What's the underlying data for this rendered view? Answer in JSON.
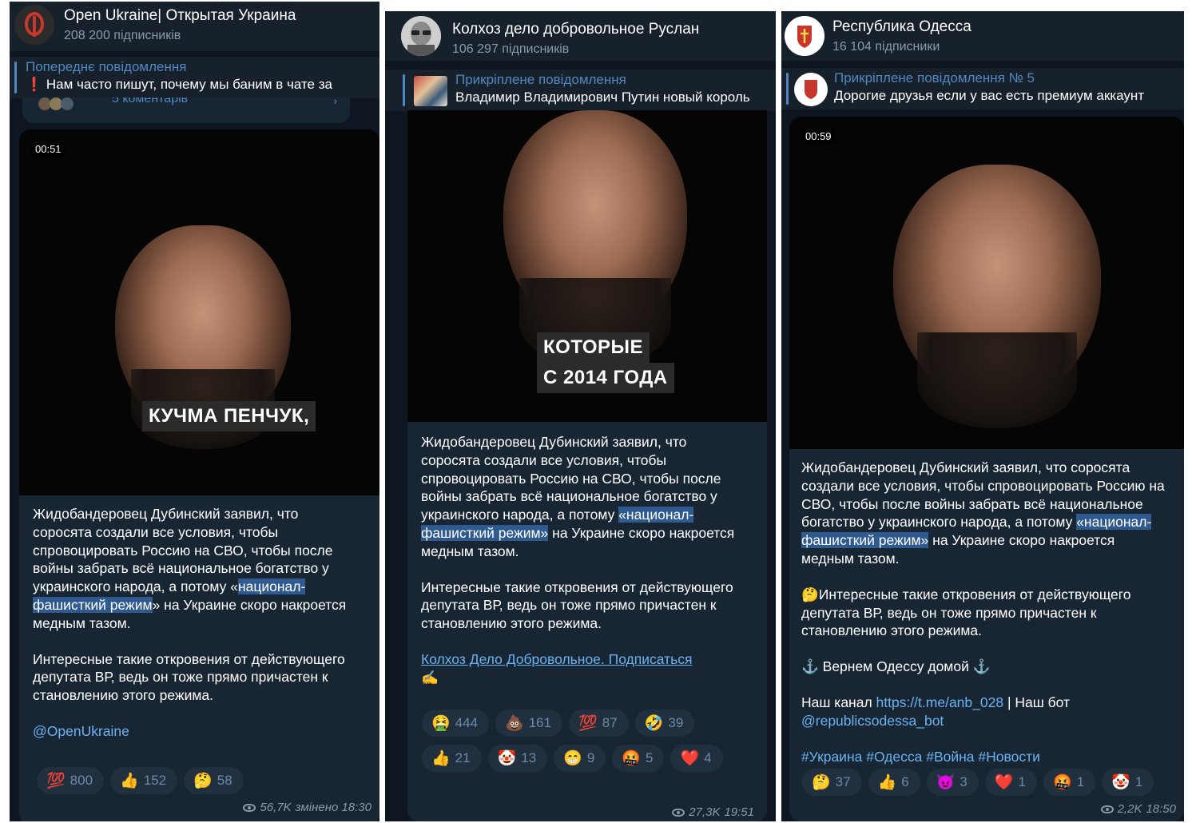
{
  "panel1": {
    "channel_title": "Open Ukraine| Открытая Украина",
    "subscribers": "208 200 підписників",
    "pinned_label": "Попереднє повідомлення",
    "pinned_text": "Нам часто пишут, почему мы баним в чате за",
    "pinned_prefix": "❗",
    "comments_peek": "5 коментарів",
    "video_time": "00:51",
    "video_caption": "КУЧМА ПЕНЧУК,",
    "body_before": "Жидобандеровец Дубинский заявил, что соросята создали все условия, чтобы спровоцировать Россию на СВО, чтобы после войны забрать всё национальное богатство у украинского народа, а потому «",
    "body_highlight": "национал-фашисткий режим",
    "body_after": "» на Украине скоро накроется медным тазом.",
    "body2": "Интересные такие откровения от действующего депутата ВР, ведь он тоже прямо причастен к становлению этого режима.",
    "signature": "@OpenUkraine",
    "reactions": [
      {
        "emoji": "💯",
        "count": "800"
      },
      {
        "emoji": "👍",
        "count": "152"
      },
      {
        "emoji": "🤔",
        "count": "58"
      }
    ],
    "views": "56,7K",
    "edited_time": "змінено 18:30"
  },
  "panel2": {
    "channel_title": "Колхоз дело добровольное Руслан",
    "subscribers": "106 297 підписників",
    "pinned_label": "Прикріплене повідомлення",
    "pinned_text": "Владимир Владимирович Путин новый король",
    "video_caption_line1": "КОТОРЫЕ",
    "video_caption_line2": "С 2014 ГОДА",
    "body_before": "Жидобандеровец Дубинский заявил, что соросята создали все условия, чтобы спровоцировать Россию на СВО, чтобы после войны забрать всё национальное богатство у украинского народа, а потому ",
    "body_highlight": "«национал-фашисткий режим»",
    "body_after": " на Украине скоро накроется медным тазом.",
    "body2": "Интересные такие откровения от действующего депутата ВР, ведь он тоже прямо причастен к становлению этого режима.",
    "link_text": "Колхоз Дело Добровольное. Подписаться ",
    "link_emoji": "✍",
    "reactions": [
      {
        "emoji": "🤮",
        "count": "444"
      },
      {
        "emoji": "💩",
        "count": "161"
      },
      {
        "emoji": "💯",
        "count": "87"
      },
      {
        "emoji": "🤣",
        "count": "39"
      },
      {
        "emoji": "👍",
        "count": "21"
      },
      {
        "emoji": "🤡",
        "count": "13"
      },
      {
        "emoji": "😁",
        "count": "9"
      },
      {
        "emoji": "🤬",
        "count": "5"
      },
      {
        "emoji": "❤️",
        "count": "4"
      }
    ],
    "views": "27,3K",
    "time": "19:51"
  },
  "panel3": {
    "channel_title": "Республика Одесса",
    "subscribers": "16 104 підписники",
    "pinned_label": "Прикріплене повідомлення № 5",
    "pinned_text": "Дорогие друзья если у вас есть премиум аккаунт",
    "video_time": "00:59",
    "body_before": "Жидобандеровец Дубинский заявил, что соросята создали все условия, чтобы спровоцировать Россию на СВО, чтобы после войны забрать всё национальное богатство у украинского народа, а потому ",
    "body_highlight": "«национал-фашисткий режим»",
    "body_after": " на Украине скоро накроется медным тазом.",
    "body2_emoji": "🤔",
    "body2": "Интересные такие откровения от действующего депутата ВР, ведь он тоже прямо причастен к становлению этого режима.",
    "slogan": "⚓ Вернем Одессу домой ⚓",
    "channel_prefix": "Наш канал ",
    "channel_link": "https://t.me/anb_028",
    "bot_prefix": " | Наш бот",
    "bot_link": "@republicsodessa_bot",
    "hashtags": "#Украина #Одесса #Война #Новости",
    "reactions": [
      {
        "emoji": "🤔",
        "count": "37"
      },
      {
        "emoji": "👍",
        "count": "6"
      },
      {
        "emoji": "😈",
        "count": "3"
      },
      {
        "emoji": "❤️",
        "count": "1"
      },
      {
        "emoji": "🤬",
        "count": "1"
      },
      {
        "emoji": "🤡",
        "count": "1"
      }
    ],
    "views": "2,2K",
    "time": "18:50"
  },
  "colors": {
    "background": "#0e1621",
    "header": "#17212b",
    "bubble": "#182533",
    "accent": "#5288c1",
    "link": "#6ab3f3",
    "highlight": "#2f5a8f"
  }
}
